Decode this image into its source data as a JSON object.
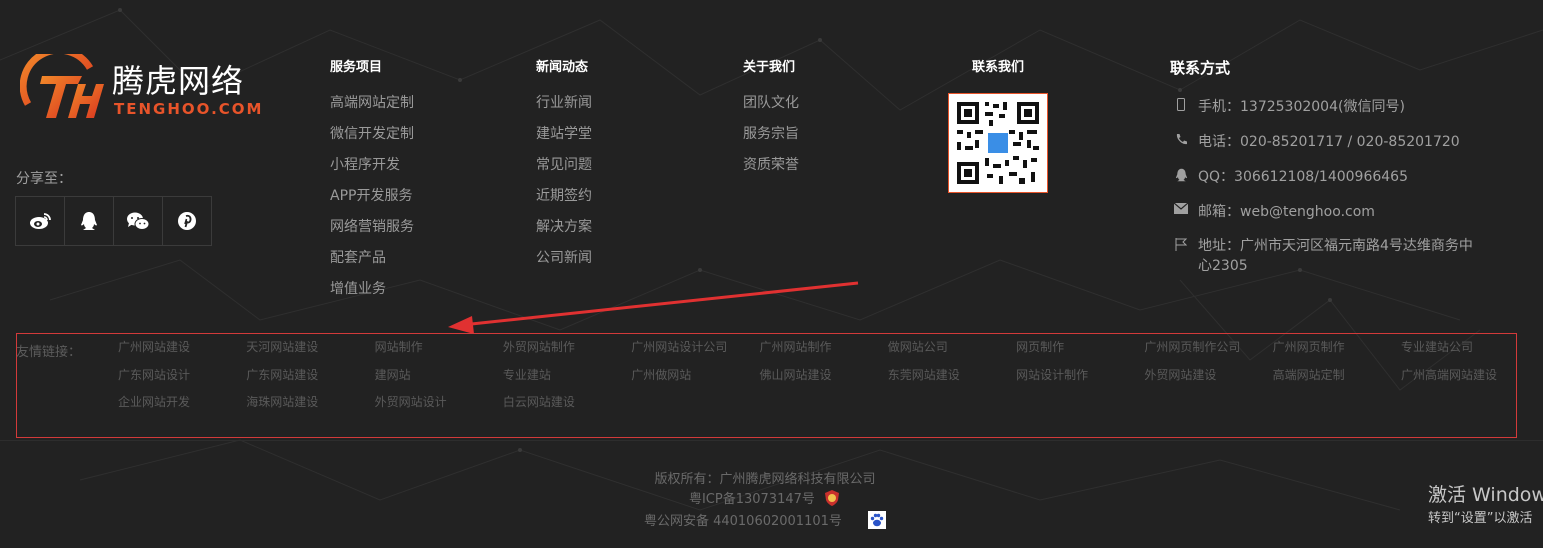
{
  "logo": {
    "name": "腾虎网络",
    "sub": "TENGHOO.COM"
  },
  "share": {
    "label": "分享至：",
    "icons": [
      "weibo-icon",
      "qq-icon",
      "wechat-icon",
      "pinterest-icon"
    ]
  },
  "columns": [
    {
      "title": "服务项目",
      "items": [
        "高端网站定制",
        "微信开发定制",
        "小程序开发",
        "APP开发服务",
        "网络营销服务",
        "配套产品",
        "增值业务"
      ]
    },
    {
      "title": "新闻动态",
      "items": [
        "行业新闻",
        "建站学堂",
        "常见问题",
        "近期签约",
        "解决方案",
        "公司新闻"
      ]
    },
    {
      "title": "关于我们",
      "items": [
        "团队文化",
        "服务宗旨",
        "资质荣誉"
      ]
    }
  ],
  "qr": {
    "title": "联系我们"
  },
  "contact": {
    "title": "联系方式",
    "phone": "手机：13725302004(微信同号)",
    "tel": "电话：020-85201717 / 020-85201720",
    "qq": "QQ：306612108/1400966465",
    "email": "邮箱：web@tenghoo.com",
    "address_line1": "地址：广州市天河区福元南路4号达维商务中",
    "address_line2": "心2305"
  },
  "friend": {
    "label": "友情链接：",
    "links": [
      "广州网站建设",
      "天河网站建设",
      "网站制作",
      "外贸网站制作",
      "广州网站设计公司",
      "广州网站制作",
      "做网站公司",
      "网页制作",
      "广州网页制作公司",
      "广州网页制作",
      "专业建站公司",
      "广东网站设计",
      "广东网站建设",
      "建网站",
      "专业建站",
      "广州做网站",
      "佛山网站建设",
      "东莞网站建设",
      "网站设计制作",
      "外贸网站建设",
      "高端网站定制",
      "广州高端网站建设",
      "企业网站开发",
      "海珠网站建设",
      "外贸网站设计",
      "白云网站建设"
    ]
  },
  "footer": {
    "copyright": "版权所有：广州腾虎网络科技有限公司",
    "icp": "粤ICP备13073147号",
    "police": "粤公网安备 44010602001101号"
  },
  "windows": {
    "title": "激活 Windows",
    "sub": "转到“设置”以激活"
  },
  "colors": {
    "accent": "#e8542a",
    "highlight_border": "#d33a3a",
    "background": "#222222"
  }
}
